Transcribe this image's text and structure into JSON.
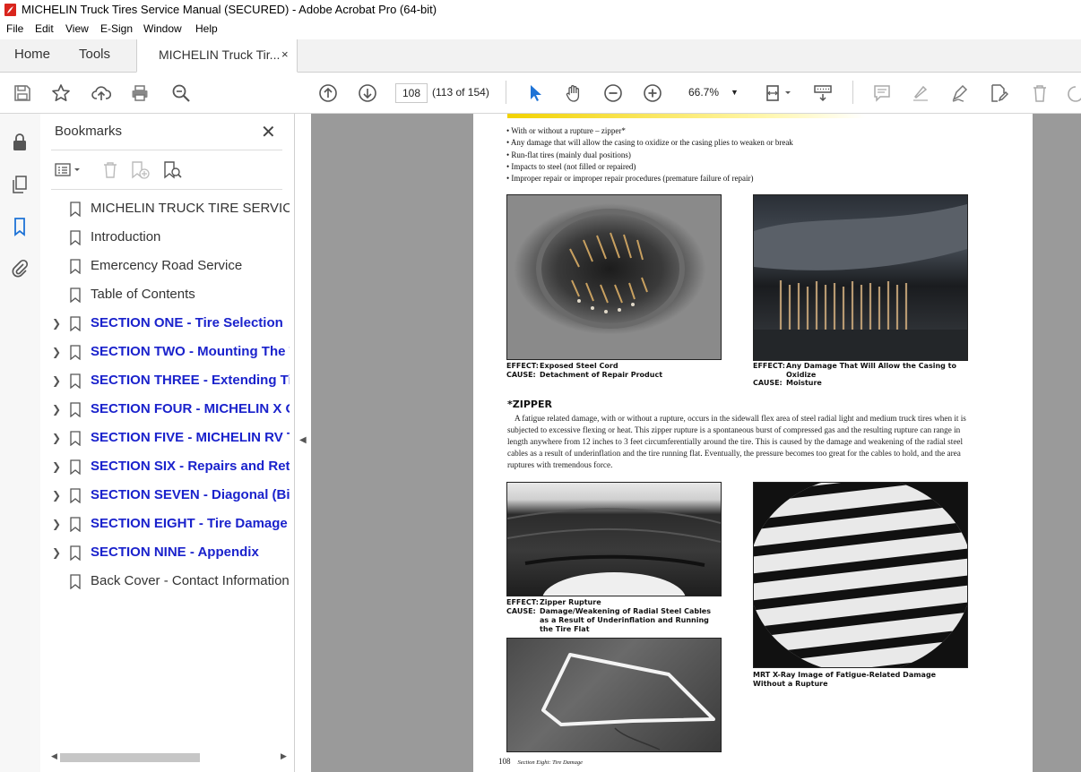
{
  "window": {
    "title": "MICHELIN Truck Tires Service Manual (SECURED) - Adobe Acrobat Pro (64-bit)"
  },
  "menu": [
    "File",
    "Edit",
    "View",
    "E-Sign",
    "Window",
    "Help"
  ],
  "tabs": {
    "home": "Home",
    "tools": "Tools",
    "document": "MICHELIN Truck Tir...",
    "close": "×"
  },
  "toolbar": {
    "page_number": "108",
    "page_count": "(113 of 154)",
    "zoom": "66.7%"
  },
  "bookmarks": {
    "title": "Bookmarks",
    "close": "✕",
    "items": [
      {
        "label": "MICHELIN TRUCK TIRE SERVICE MANUAL",
        "section": false,
        "expandable": false
      },
      {
        "label": "Introduction",
        "section": false,
        "expandable": false
      },
      {
        "label": "Emercency Road Service",
        "section": false,
        "expandable": false
      },
      {
        "label": "Table of Contents",
        "section": false,
        "expandable": false
      },
      {
        "label": "SECTION ONE - Tire Selection",
        "section": true,
        "expandable": true
      },
      {
        "label": "SECTION TWO - Mounting The Tire",
        "section": true,
        "expandable": true
      },
      {
        "label": "SECTION THREE -  Extending Tire Life",
        "section": true,
        "expandable": true
      },
      {
        "label": "SECTION FOUR - MICHELIN X One",
        "section": true,
        "expandable": true
      },
      {
        "label": "SECTION FIVE - MICHELIN RV Tires",
        "section": true,
        "expandable": true
      },
      {
        "label": "SECTION SIX - Repairs and Retreading",
        "section": true,
        "expandable": true
      },
      {
        "label": "SECTION SEVEN - Diagonal (Bias)",
        "section": true,
        "expandable": true
      },
      {
        "label": "SECTION EIGHT - Tire Damage",
        "section": true,
        "expandable": true
      },
      {
        "label": "SECTION NINE - Appendix",
        "section": true,
        "expandable": true
      },
      {
        "label": "Back Cover - Contact Information",
        "section": false,
        "expandable": false
      }
    ]
  },
  "document": {
    "bullets": [
      "With or without a rupture – zipper*",
      "Any damage that will allow the casing to oxidize or the casing plies to weaken or break",
      "Run-flat tires (mainly dual positions)",
      "Impacts to steel (not filled or repaired)",
      "Improper repair or improper repair procedures (premature failure of repair)"
    ],
    "captions": {
      "c1_effect": "Exposed Steel Cord",
      "c1_cause": "Detachment of Repair Product",
      "c2_effect": "Any Damage That Will Allow the Casing to Oxidize",
      "c2_cause": "Moisture",
      "c3_effect": "Zipper Rupture",
      "c3_cause": "Damage/Weakening of Radial Steel Cables as a Result of Underinflation and Running the Tire Flat",
      "c4": "MRT X-Ray Image of Fatigue-Related Damage Without a Rupture",
      "effect_label": "EFFECT:",
      "cause_label": "CAUSE:"
    },
    "zipper_heading": "*ZIPPER",
    "zipper_body": "A fatigue related damage, with or without a rupture, occurs in the sidewall flex area of steel radial light and medium truck tires when it is subjected to excessive flexing or heat. This zipper rupture is a spontaneous burst of compressed gas and the resulting rupture can range in length anywhere from 12 inches to 3 feet circumferentially around the tire. This is caused by the damage and weakening of the radial steel cables as a result of underinflation and the tire running flat. Eventually, the pressure becomes too great for the cables to hold, and the area ruptures with tremendous force.",
    "footer_page": "108",
    "footer_section": "Section Eight: Tire Damage"
  }
}
